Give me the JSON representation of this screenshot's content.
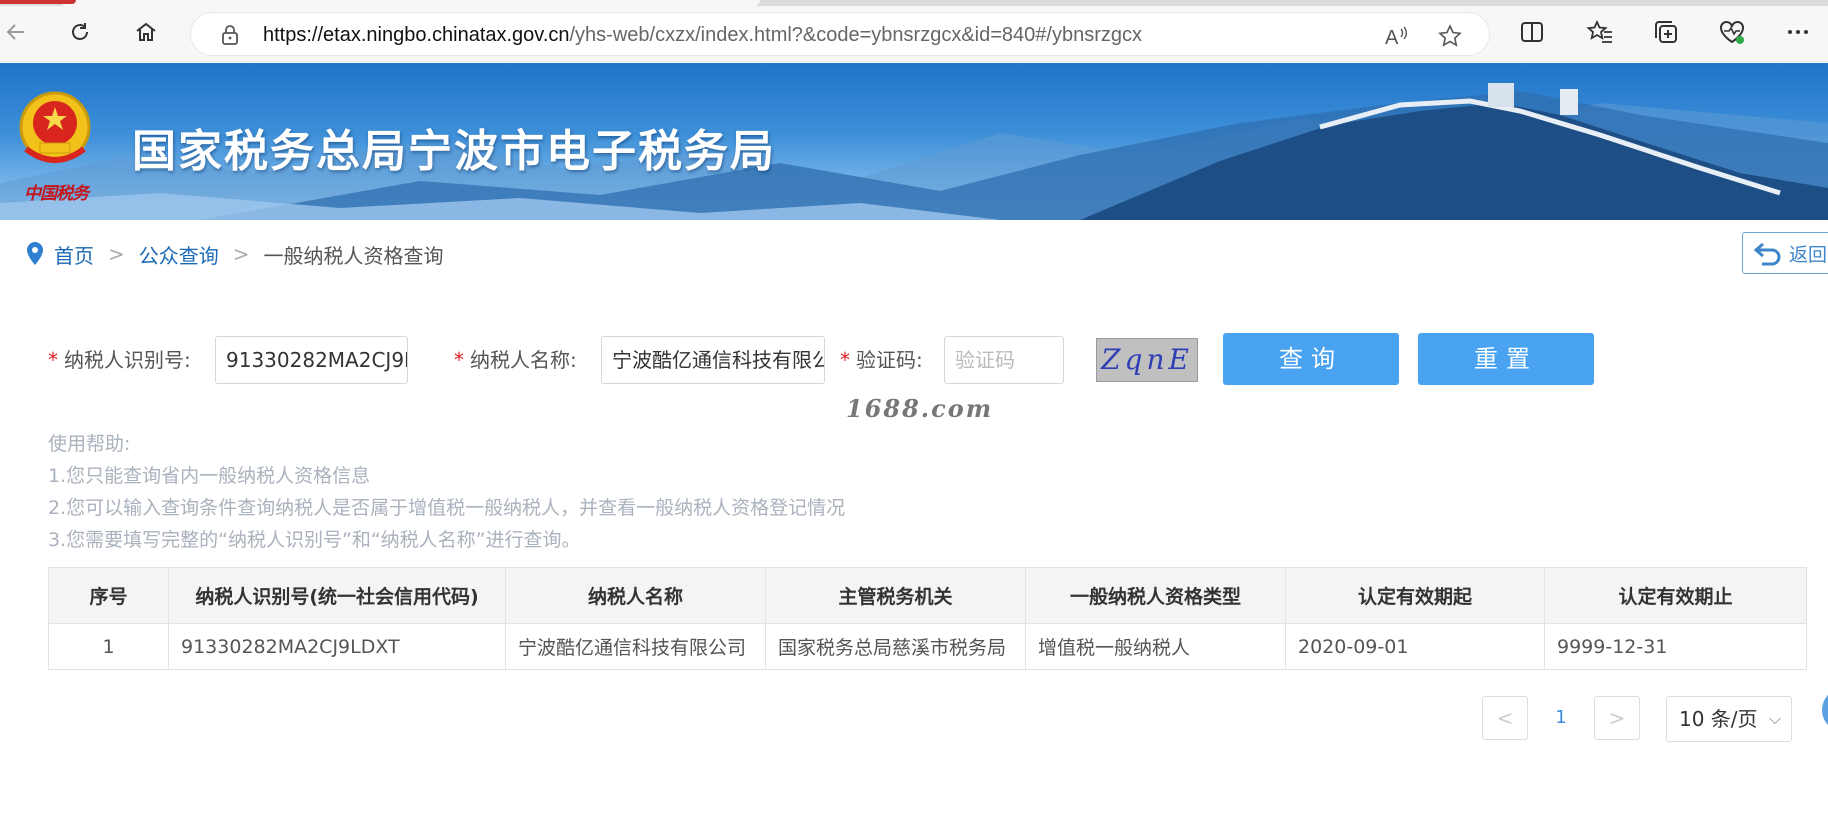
{
  "browser": {
    "url_host": "https://etax.ningbo.chinatax.gov.cn",
    "url_path": "/yhs-web/cxzx/index.html?&code=ybnsrzgcx&id=840#/ybnsrzgcx"
  },
  "banner": {
    "title": "国家税务总局宁波市电子税务局",
    "emblem_caption": "中国税务"
  },
  "breadcrumb": {
    "home": "首页",
    "sep1": ">",
    "public_query": "公众查询",
    "sep2": ">",
    "current": "一般纳税人资格查询",
    "back_label": "返回"
  },
  "form": {
    "taxpayer_id_label": "纳税人识别号:",
    "taxpayer_id_value": "91330282MA2CJ9LDXT",
    "taxpayer_name_label": "纳税人名称:",
    "taxpayer_name_value": "宁波酷亿通信科技有限公司",
    "captcha_label": "验证码:",
    "captcha_placeholder": "验证码",
    "captcha_image_text": "ZqnE",
    "required_mark": "*",
    "query_button": "查询",
    "reset_button": "重置",
    "watermark": "1688.com"
  },
  "help": {
    "title": "使用帮助:",
    "items": [
      "1.您只能查询省内一般纳税人资格信息",
      "2.您可以输入查询条件查询纳税人是否属于增值税一般纳税人，并查看一般纳税人资格登记情况",
      "3.您需要填写完整的“纳税人识别号”和“纳税人名称”进行查询。"
    ]
  },
  "table": {
    "columns": [
      "序号",
      "纳税人识别号(统一社会信用代码)",
      "纳税人名称",
      "主管税务机关",
      "一般纳税人资格类型",
      "认定有效期起",
      "认定有效期止"
    ],
    "rows": [
      [
        "1",
        "91330282MA2CJ9LDXT",
        "宁波酷亿通信科技有限公司",
        "国家税务总局慈溪市税务局",
        "增值税一般纳税人",
        "2020-09-01",
        "9999-12-31"
      ]
    ]
  },
  "pagination": {
    "prev": "<",
    "page": "1",
    "next": ">",
    "page_size": "10 条/页",
    "chevron": "⌵"
  },
  "colors": {
    "primary_button": "#4aa3f1",
    "link": "#1b69b6",
    "required": "#e02020"
  }
}
